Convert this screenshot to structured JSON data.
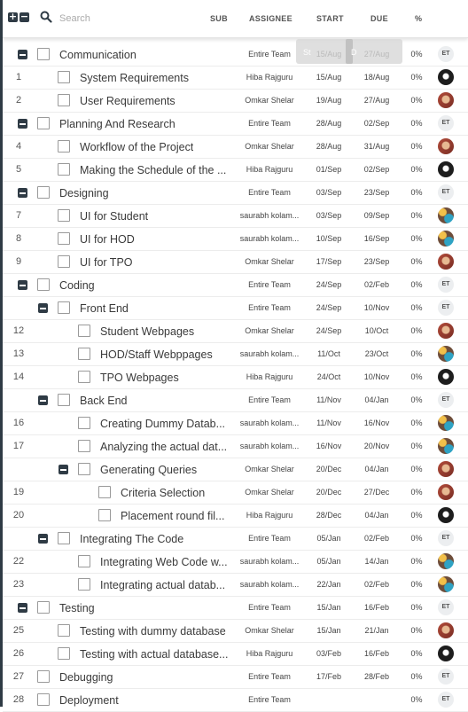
{
  "header": {
    "expand_all_label": "+",
    "collapse_all_label": "−",
    "search_placeholder": "Search",
    "columns": {
      "sub": "SUB",
      "assignee": "ASSIGNEE",
      "start": "START",
      "due": "DUE",
      "pct": "%"
    }
  },
  "tooltip": {
    "left": "St",
    "right": "D"
  },
  "rows": [
    {
      "num": "",
      "level": 0,
      "group": true,
      "name": "Communication",
      "assignee": "Entire Team",
      "start": "15/Aug",
      "due": "27/Aug",
      "pct": "0%",
      "avatar": "ET"
    },
    {
      "num": "1",
      "level": 1,
      "group": false,
      "name": "System Requirements",
      "assignee": "Hiba Rajguru",
      "start": "15/Aug",
      "due": "18/Aug",
      "pct": "0%",
      "avatar": "a3"
    },
    {
      "num": "2",
      "level": 1,
      "group": false,
      "name": "User Requirements",
      "assignee": "Omkar Shelar",
      "start": "19/Aug",
      "due": "27/Aug",
      "pct": "0%",
      "avatar": "a2"
    },
    {
      "num": "",
      "level": 0,
      "group": true,
      "name": "Planning And Research",
      "assignee": "Entire Team",
      "start": "28/Aug",
      "due": "02/Sep",
      "pct": "0%",
      "avatar": "ET"
    },
    {
      "num": "4",
      "level": 1,
      "group": false,
      "name": "Workflow of the Project",
      "assignee": "Omkar Shelar",
      "start": "28/Aug",
      "due": "31/Aug",
      "pct": "0%",
      "avatar": "a2"
    },
    {
      "num": "5",
      "level": 1,
      "group": false,
      "name": "Making the Schedule of the ...",
      "assignee": "Hiba Rajguru",
      "start": "01/Sep",
      "due": "02/Sep",
      "pct": "0%",
      "avatar": "a3"
    },
    {
      "num": "",
      "level": 0,
      "group": true,
      "name": "Designing",
      "assignee": "Entire Team",
      "start": "03/Sep",
      "due": "23/Sep",
      "pct": "0%",
      "avatar": "ET"
    },
    {
      "num": "7",
      "level": 1,
      "group": false,
      "name": "UI for Student",
      "assignee": "saurabh kolam...",
      "start": "03/Sep",
      "due": "09/Sep",
      "pct": "0%",
      "avatar": "a4"
    },
    {
      "num": "8",
      "level": 1,
      "group": false,
      "name": "UI for HOD",
      "assignee": "saurabh kolam...",
      "start": "10/Sep",
      "due": "16/Sep",
      "pct": "0%",
      "avatar": "a4"
    },
    {
      "num": "9",
      "level": 1,
      "group": false,
      "name": "UI for TPO",
      "assignee": "Omkar Shelar",
      "start": "17/Sep",
      "due": "23/Sep",
      "pct": "0%",
      "avatar": "a2"
    },
    {
      "num": "",
      "level": 0,
      "group": true,
      "name": "Coding",
      "assignee": "Entire Team",
      "start": "24/Sep",
      "due": "02/Feb",
      "pct": "0%",
      "avatar": "ET"
    },
    {
      "num": "",
      "level": 1,
      "group": true,
      "name": "Front End",
      "assignee": "Entire Team",
      "start": "24/Sep",
      "due": "10/Nov",
      "pct": "0%",
      "avatar": "ET"
    },
    {
      "num": "12",
      "level": 2,
      "group": false,
      "name": "Student Webpages",
      "assignee": "Omkar Shelar",
      "start": "24/Sep",
      "due": "10/Oct",
      "pct": "0%",
      "avatar": "a2"
    },
    {
      "num": "13",
      "level": 2,
      "group": false,
      "name": "HOD/Staff Webppages",
      "assignee": "saurabh kolam...",
      "start": "11/Oct",
      "due": "23/Oct",
      "pct": "0%",
      "avatar": "a4"
    },
    {
      "num": "14",
      "level": 2,
      "group": false,
      "name": "TPO Webpages",
      "assignee": "Hiba Rajguru",
      "start": "24/Oct",
      "due": "10/Nov",
      "pct": "0%",
      "avatar": "a3"
    },
    {
      "num": "",
      "level": 1,
      "group": true,
      "name": "Back End",
      "assignee": "Entire Team",
      "start": "11/Nov",
      "due": "04/Jan",
      "pct": "0%",
      "avatar": "ET"
    },
    {
      "num": "16",
      "level": 2,
      "group": false,
      "name": "Creating Dummy Datab...",
      "assignee": "saurabh kolam...",
      "start": "11/Nov",
      "due": "16/Nov",
      "pct": "0%",
      "avatar": "a4"
    },
    {
      "num": "17",
      "level": 2,
      "group": false,
      "name": "Analyzing the actual dat...",
      "assignee": "saurabh kolam...",
      "start": "16/Nov",
      "due": "20/Nov",
      "pct": "0%",
      "avatar": "a4"
    },
    {
      "num": "",
      "level": 2,
      "group": true,
      "name": "Generating Queries",
      "assignee": "Omkar Shelar",
      "start": "20/Dec",
      "due": "04/Jan",
      "pct": "0%",
      "avatar": "a2"
    },
    {
      "num": "19",
      "level": 3,
      "group": false,
      "name": "Criteria Selection",
      "assignee": "Omkar Shelar",
      "start": "20/Dec",
      "due": "27/Dec",
      "pct": "0%",
      "avatar": "a2"
    },
    {
      "num": "20",
      "level": 3,
      "group": false,
      "name": "Placement round fil...",
      "assignee": "Hiba Rajguru",
      "start": "28/Dec",
      "due": "04/Jan",
      "pct": "0%",
      "avatar": "a3"
    },
    {
      "num": "",
      "level": 1,
      "group": true,
      "name": "Integrating The Code",
      "assignee": "Entire Team",
      "start": "05/Jan",
      "due": "02/Feb",
      "pct": "0%",
      "avatar": "ET"
    },
    {
      "num": "22",
      "level": 2,
      "group": false,
      "name": "Integrating Web Code w...",
      "assignee": "saurabh kolam...",
      "start": "05/Jan",
      "due": "14/Jan",
      "pct": "0%",
      "avatar": "a4"
    },
    {
      "num": "23",
      "level": 2,
      "group": false,
      "name": "Integrating actual datab...",
      "assignee": "saurabh kolam...",
      "start": "22/Jan",
      "due": "02/Feb",
      "pct": "0%",
      "avatar": "a4"
    },
    {
      "num": "",
      "level": 0,
      "group": true,
      "name": "Testing",
      "assignee": "Entire Team",
      "start": "15/Jan",
      "due": "16/Feb",
      "pct": "0%",
      "avatar": "ET"
    },
    {
      "num": "25",
      "level": 1,
      "group": false,
      "name": "Testing with dummy database",
      "assignee": "Omkar Shelar",
      "start": "15/Jan",
      "due": "21/Jan",
      "pct": "0%",
      "avatar": "a2"
    },
    {
      "num": "26",
      "level": 1,
      "group": false,
      "name": "Testing with actual database...",
      "assignee": "Hiba Rajguru",
      "start": "03/Feb",
      "due": "16/Feb",
      "pct": "0%",
      "avatar": "a3"
    },
    {
      "num": "27",
      "level": 0,
      "group": false,
      "name": "Debugging",
      "assignee": "Entire Team",
      "start": "17/Feb",
      "due": "28/Feb",
      "pct": "0%",
      "avatar": "ET"
    },
    {
      "num": "28",
      "level": 0,
      "group": false,
      "name": "Deployment",
      "assignee": "Entire Team",
      "start": "",
      "due": "",
      "pct": "0%",
      "avatar": "ET"
    }
  ]
}
